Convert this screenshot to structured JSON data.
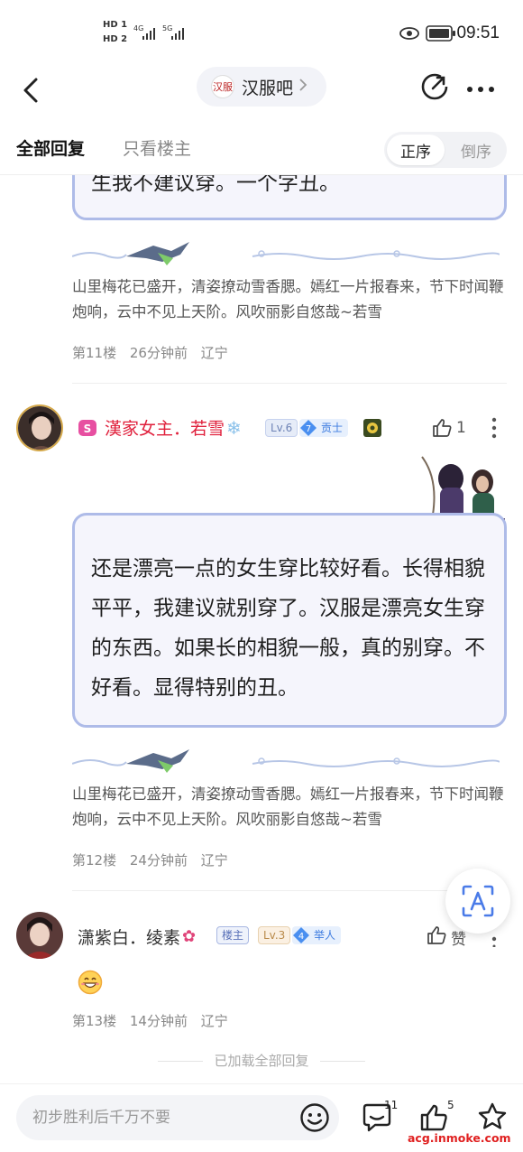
{
  "status_bar": {
    "hd1": "HD 1",
    "hd2": "HD 2",
    "net1": "4G",
    "net2": "5G",
    "time": "09:51"
  },
  "nav": {
    "forum_logo_text": "汉服",
    "forum_name": "汉服吧"
  },
  "tabs": {
    "all_replies": "全部回复",
    "op_only": "只看楼主",
    "order_asc": "正序",
    "order_desc": "倒序"
  },
  "posts": [
    {
      "content_tail": "生我不建议穿。一个字丑。",
      "signature": "山里梅花已盛开，清姿撩动雪香腮。嫣红一片报春来，节下时闻鞭炮响，云中不见上天阶。风吹丽影自悠哉~若雪",
      "floor": "第11楼",
      "time": "26分钟前",
      "location": "辽宁"
    },
    {
      "username": "漢家女主．若雪",
      "level": "Lv.6",
      "rank_num": "7",
      "rank_name": "贡士",
      "likes": "1",
      "content": "还是漂亮一点的女生穿比较好看。长得相貌平平，我建议就别穿了。汉服是漂亮女生穿的东西。如果长的相貌一般，真的别穿。不好看。显得特别的丑。",
      "signature": "山里梅花已盛开，清姿撩动雪香腮。嫣红一片报春来，节下时闻鞭炮响，云中不见上天阶。风吹丽影自悠哉~若雪",
      "floor": "第12楼",
      "time": "24分钟前",
      "location": "辽宁"
    },
    {
      "username": "潇紫白．绫素",
      "op_badge": "楼主",
      "level": "Lv.3",
      "rank_num": "4",
      "rank_name": "举人",
      "like_label": "赞",
      "floor": "第13楼",
      "time": "14分钟前",
      "location": "辽宁"
    }
  ],
  "loaded_all": "已加载全部回复",
  "bottom_bar": {
    "input_placeholder": "初步胜利后千万不要",
    "comment_count": "11",
    "like_count": "5"
  },
  "watermark": "acg.inmoke.com",
  "colors": {
    "accent_blue": "#4a7be8",
    "bubble_border": "#aebbe8",
    "username_red": "#e0203c",
    "watermark_red": "#e02020"
  }
}
